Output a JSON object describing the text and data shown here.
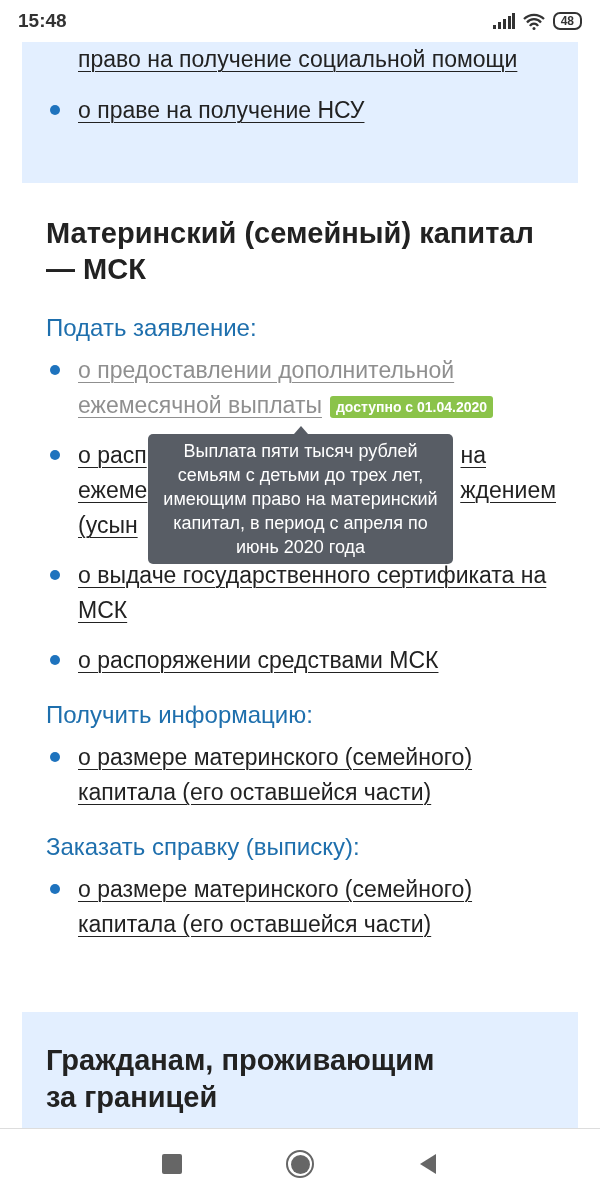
{
  "status_bar": {
    "time": "15:48",
    "battery": "48"
  },
  "top_card": {
    "items": [
      {
        "text": "право на получение социальной помощи",
        "bullet": false
      },
      {
        "text": "о праве на получение НСУ",
        "bullet": true
      }
    ]
  },
  "section": {
    "title": "Материнский (семейный) капитал — МСК",
    "groups": [
      {
        "heading": "Подать заявление:",
        "items": [
          {
            "kind": "link",
            "text": "о предоставлении дополнительной ежемесячной выплаты",
            "disabled": true,
            "badge": "доступно с 01.04.2020"
          },
          {
            "kind": "covered",
            "disabled": false,
            "lines": [
              {
                "left": "о расп",
                "right": "на"
              },
              {
                "left": "ежеме",
                "right": "ждением"
              },
              {
                "left": "(усын"
              }
            ]
          },
          {
            "kind": "link",
            "text": "о выдаче государственного сертификата на МСК",
            "disabled": false
          },
          {
            "kind": "link",
            "text": "о распоряжении средствами МСК",
            "disabled": false
          }
        ]
      },
      {
        "heading": "Получить информацию:",
        "items": [
          {
            "kind": "link",
            "text": "о размере материнского (семейного) капитала (его оставшейся части)",
            "disabled": false
          }
        ]
      },
      {
        "heading": "Заказать справку (выписку):",
        "items": [
          {
            "kind": "link",
            "text": "о размере материнского (семейного) капитала (его оставшейся части)",
            "disabled": false
          }
        ]
      }
    ]
  },
  "tooltip": {
    "text": "Выплата пяти тысяч рублей семьям с детьми до трех лет, имеющим право на материнский капитал, в период с апреля по июнь 2020 года"
  },
  "bottom_card": {
    "title": "Гражданам, проживающим за границей"
  }
}
